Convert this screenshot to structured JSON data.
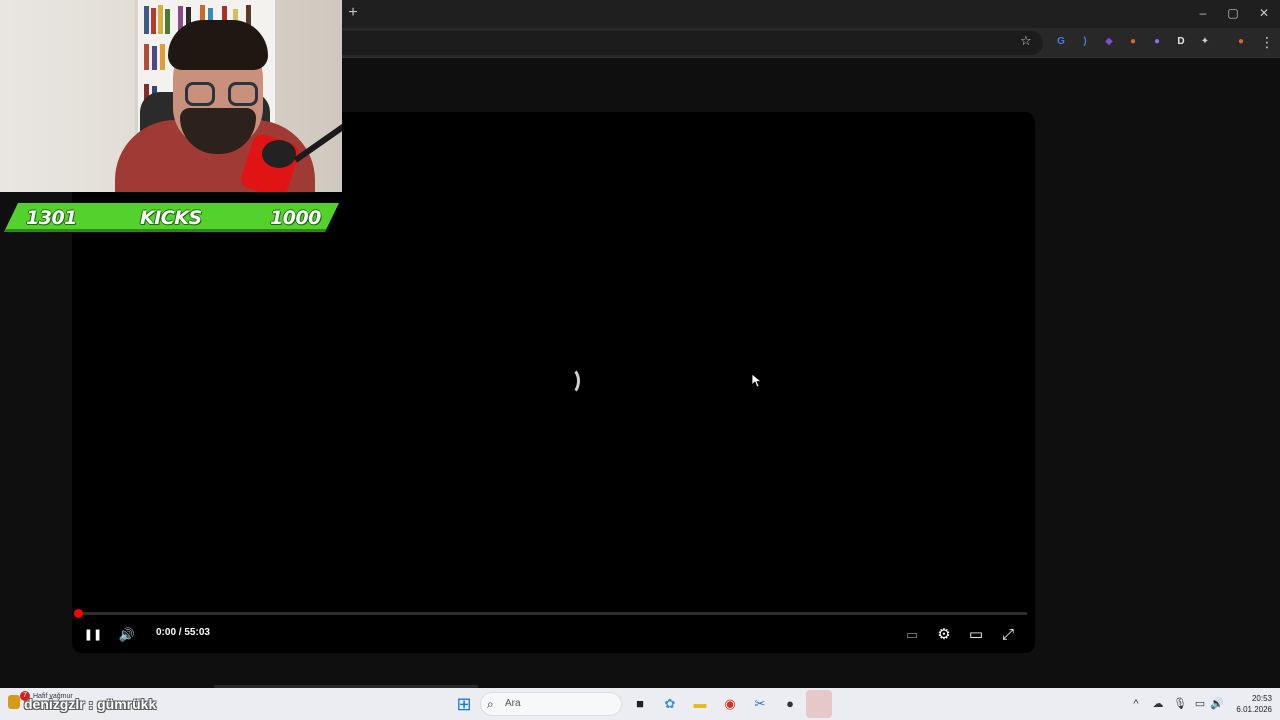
{
  "browser": {
    "new_tab_label": "+",
    "window_controls": {
      "minimize": "–",
      "restore": "▢",
      "close": "✕"
    },
    "star_glyph": "☆",
    "menu_glyph": "⋮",
    "extensions": [
      {
        "name": "translate-extension-icon",
        "glyph": "G",
        "color": "#4a79d8"
      },
      {
        "name": "audio-extension-icon",
        "glyph": ")",
        "color": "#4a79d8"
      },
      {
        "name": "shield-extension-icon",
        "glyph": "◆",
        "color": "#7b4fd6"
      },
      {
        "name": "fox-extension-icon",
        "glyph": "●",
        "color": "#e0652a"
      },
      {
        "name": "cloud-extension-icon",
        "glyph": "●",
        "color": "#8a6fe0"
      },
      {
        "name": "d-extension-icon",
        "glyph": "D",
        "color": "#e8e8e8"
      },
      {
        "name": "puzzle-extensions-icon",
        "glyph": "✦",
        "color": "#cfcfcf"
      },
      {
        "name": "profile-avatar-icon",
        "glyph": "●",
        "color": "#c76b3a"
      }
    ]
  },
  "overlay": {
    "kicks_left": "1301",
    "kicks_label": "KICKS",
    "kicks_right": "1000"
  },
  "player": {
    "time_current": "0:00",
    "time_separator": " / ",
    "time_total": "55:03",
    "progress_fraction": 0.0,
    "play_state": "playing",
    "pause_glyph": "❚❚",
    "volume_glyph": "🔊",
    "subtitles_glyph": "▭",
    "settings_glyph": "⚙",
    "theater_glyph": "▭",
    "fullscreen_glyph": "⤢"
  },
  "taskbar": {
    "weather_badge": "7",
    "weather_text": "Hafif yağmur",
    "chat_text": "denizgzlr : gümrükk",
    "search_placeholder": "Ara",
    "clock_time": "20:53",
    "clock_date": "6.01.2026",
    "apps": [
      {
        "name": "start-button-icon",
        "glyph": "⊞",
        "color": "#1a7ad4"
      },
      {
        "name": "widgets-app-icon",
        "glyph": "☁",
        "color": "#555"
      },
      {
        "name": "terminal-app-icon",
        "glyph": "■",
        "color": "#222"
      },
      {
        "name": "copilot-app-icon",
        "glyph": "✿",
        "color": "#3a8ee6"
      },
      {
        "name": "file-explorer-icon",
        "glyph": "▬",
        "color": "#e8b820"
      },
      {
        "name": "chrome-app-icon",
        "glyph": "◉",
        "color": "#d93025"
      },
      {
        "name": "snipping-tool-icon",
        "glyph": "✂",
        "color": "#2a6ad8"
      },
      {
        "name": "obs-app-icon",
        "glyph": "●",
        "color": "#333"
      },
      {
        "name": "send-app-icon",
        "glyph": "➤",
        "color": "#2a8ad8"
      }
    ],
    "tray": [
      {
        "name": "tray-chevron-icon",
        "glyph": "^"
      },
      {
        "name": "onedrive-icon",
        "glyph": "☁"
      },
      {
        "name": "microphone-icon",
        "glyph": "🎙"
      },
      {
        "name": "network-icon",
        "glyph": "▭"
      },
      {
        "name": "volume-tray-icon",
        "glyph": "🔊"
      }
    ]
  }
}
